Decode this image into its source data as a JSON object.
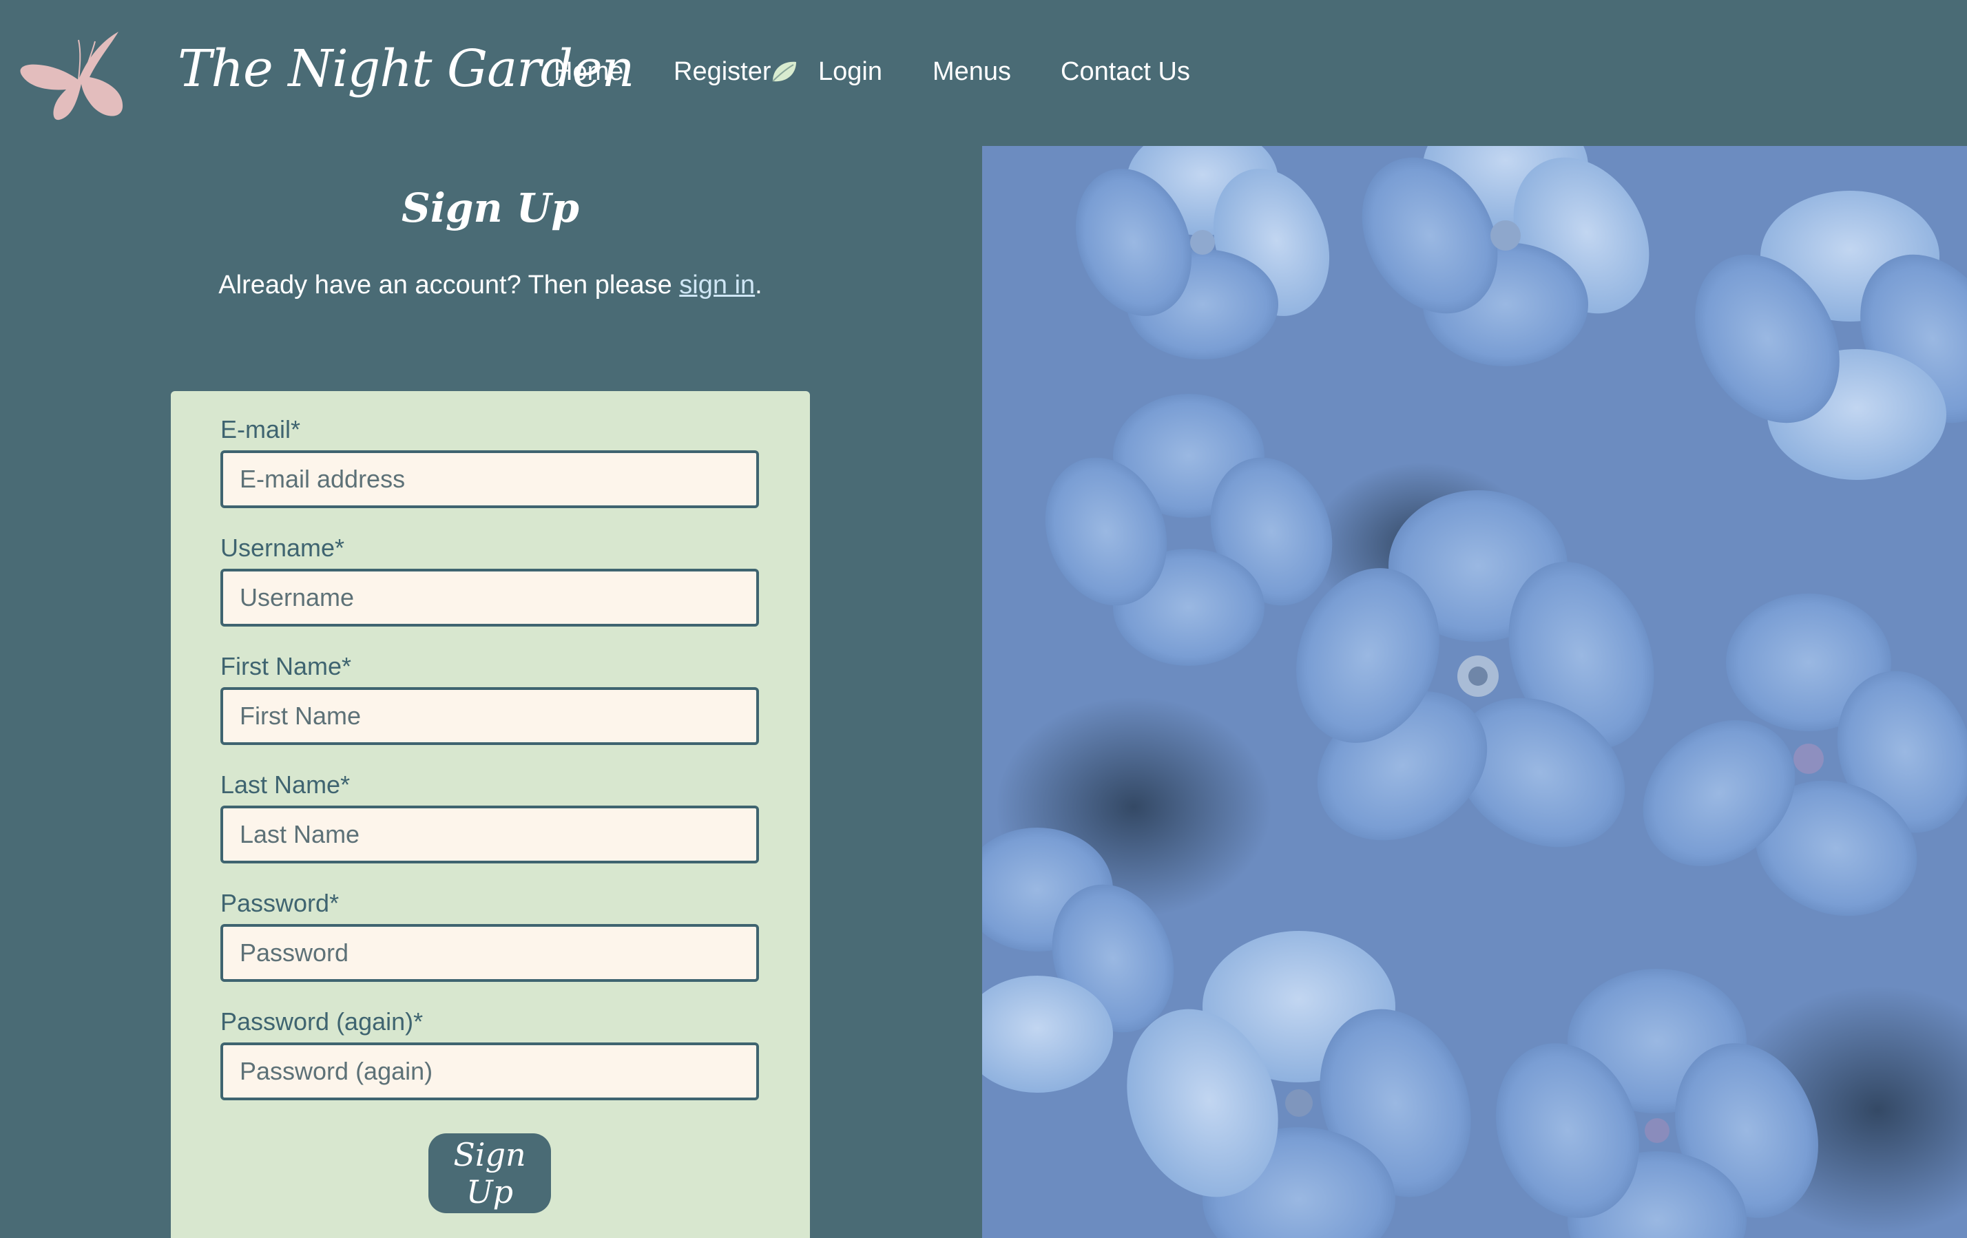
{
  "nav": {
    "logo": "butterfly-icon",
    "brand": "The Night Garden",
    "links": [
      "Home",
      "Register",
      "Login",
      "Menus",
      "Contact Us"
    ],
    "register_icon": "leaf-icon"
  },
  "signup": {
    "heading": "Sign Up",
    "lead_prefix": "Already have an account? Then please ",
    "lead_link": "sign in",
    "lead_suffix": ".",
    "fields": [
      {
        "label": "E-mail*",
        "placeholder": "E-mail address"
      },
      {
        "label": "Username*",
        "placeholder": "Username"
      },
      {
        "label": "First Name*",
        "placeholder": "First Name"
      },
      {
        "label": "Last Name*",
        "placeholder": "Last Name"
      },
      {
        "label": "Password*",
        "placeholder": "Password"
      },
      {
        "label": "Password (again)*",
        "placeholder": "Password (again)"
      }
    ],
    "submit_label": "Sign Up"
  },
  "colors": {
    "background": "#4a6b75",
    "form_card": "#d8e7cf",
    "input_fill": "#fdf5eb",
    "logo_pink": "#e3bdbd",
    "accent_text": "#3f6470"
  },
  "hero_image": "blue-hydrangea-flowers"
}
